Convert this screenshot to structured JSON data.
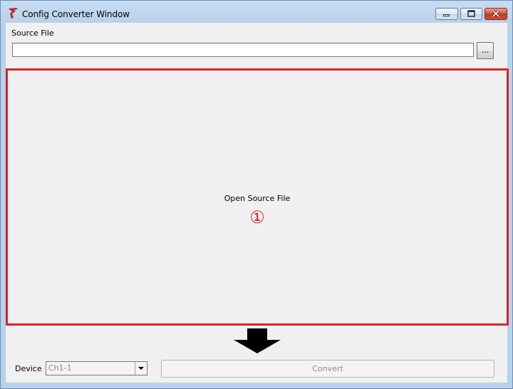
{
  "window": {
    "title": "Config Converter Window"
  },
  "source_file": {
    "label": "Source File",
    "value": "",
    "browse_label": "..."
  },
  "drop_area": {
    "text": "Open Source File",
    "step_marker": "①",
    "border_color": "#d4262b"
  },
  "device": {
    "label": "Device",
    "selected": "Ch1-1"
  },
  "convert": {
    "label": "Convert",
    "enabled": false
  },
  "icons": {
    "app": "app-logo-icon",
    "minimize": "minimize-icon",
    "maximize": "maximize-icon",
    "close": "close-icon",
    "dropdown": "chevron-down-icon",
    "arrow": "arrow-down-icon"
  }
}
